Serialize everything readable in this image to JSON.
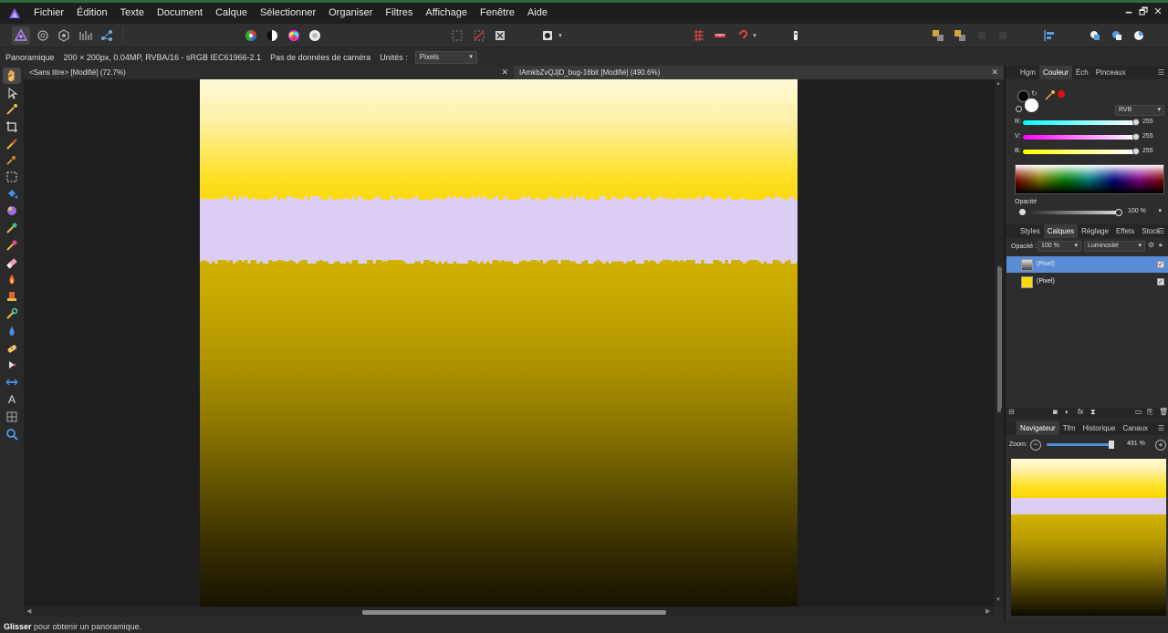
{
  "menubar": {
    "items": [
      "Fichier",
      "Édition",
      "Texte",
      "Document",
      "Calque",
      "Sélectionner",
      "Organiser",
      "Filtres",
      "Affichage",
      "Fenêtre",
      "Aide"
    ],
    "minimize": "🗕",
    "maximize": "🗗",
    "close": "✕"
  },
  "context": {
    "tool_name": "Panoramique",
    "doc_info": "200 × 200px, 0.04MP, RVBA/16 - sRGB IEC61966-2.1",
    "camera": "Pas de données de caméra",
    "units_label": "Unités :",
    "units_value": "Pixels"
  },
  "tabs": [
    {
      "label": "<Sans titre> [Modifié] (72.7%)",
      "close": "✕"
    },
    {
      "label": "IAmkbZvQJjD_bug-16bit [Modifié] (490.6%)",
      "close": "✕"
    }
  ],
  "colour_panel": {
    "tabs": [
      "Hgm",
      "Couleur",
      "Éch",
      "Pinceaux"
    ],
    "model": "RVB",
    "r_label": "R:",
    "r_value": "255",
    "v_label": "V:",
    "v_value": "255",
    "b_label": "B:",
    "b_value": "255",
    "opacity_label": "Opacité",
    "opacity_value": "100 %"
  },
  "layers_panel": {
    "tabs": [
      "Styles",
      "Calques",
      "Réglage",
      "Effets",
      "Stock"
    ],
    "opacity_label": "Opacité :",
    "opacity_value": "100 %",
    "blend_mode": "Luminosité",
    "layers": [
      {
        "name": "(Pixel)",
        "selected": true,
        "visible": true
      },
      {
        "name": "(Pixel)",
        "selected": false,
        "visible": true
      }
    ]
  },
  "navigator_panel": {
    "tabs": [
      "Navigateur",
      "Tfm",
      "Historique",
      "Canaux"
    ],
    "zoom_label": "Zoom:",
    "zoom_value": "491 %"
  },
  "status": {
    "bold": "Glisser",
    "text": " pour obtenir un panoramique."
  },
  "colors": {
    "selection": "#5a8bd6",
    "band": "#dccdf5",
    "yellow": "#fcd80c",
    "red_swatch": "#e01010"
  }
}
